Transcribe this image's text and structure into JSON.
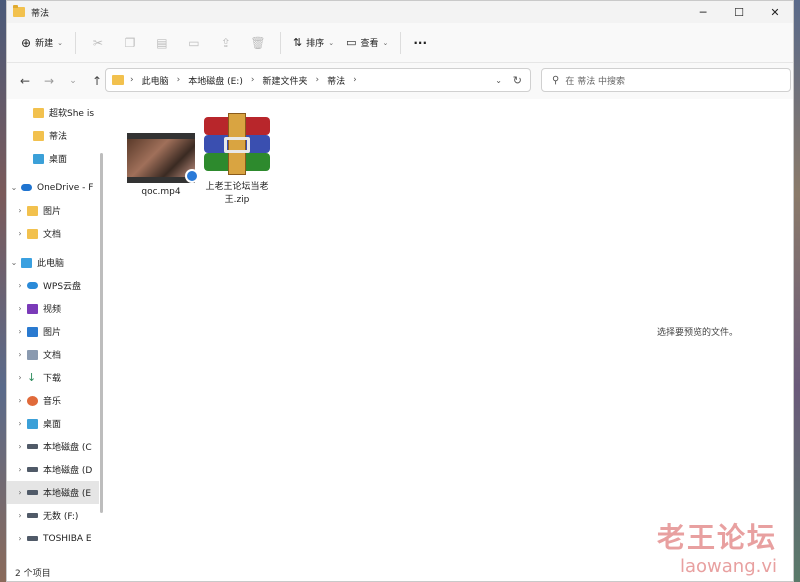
{
  "window": {
    "title": "蒂法"
  },
  "window_controls": {
    "minimize": "─",
    "maximize": "☐",
    "close": "✕"
  },
  "toolbar": {
    "new_label": "新建",
    "sort_label": "排序",
    "view_label": "查看",
    "more_label": "···"
  },
  "address_bar": {
    "crumbs": [
      "此电脑",
      "本地磁盘 (E:)",
      "新建文件夹",
      "蒂法"
    ]
  },
  "search": {
    "placeholder": "在 蒂法 中搜索"
  },
  "sidebar": {
    "items": [
      {
        "label": "超软She is",
        "icon": "folder-icon"
      },
      {
        "label": "蒂法",
        "icon": "folder-icon"
      },
      {
        "label": "桌面",
        "icon": "desktop-icon"
      },
      {
        "label": "OneDrive - F",
        "icon": "cloud-icon"
      },
      {
        "label": "图片",
        "icon": "folder-icon"
      },
      {
        "label": "文档",
        "icon": "folder-icon"
      },
      {
        "label": "此电脑",
        "icon": "computer-icon"
      },
      {
        "label": "WPS云盘",
        "icon": "cloud-icon"
      },
      {
        "label": "视频",
        "icon": "video-icon"
      },
      {
        "label": "图片",
        "icon": "picture-icon"
      },
      {
        "label": "文档",
        "icon": "document-icon"
      },
      {
        "label": "下载",
        "icon": "download-icon"
      },
      {
        "label": "音乐",
        "icon": "music-icon"
      },
      {
        "label": "桌面",
        "icon": "desktop-icon"
      },
      {
        "label": "本地磁盘 (C",
        "icon": "drive-icon"
      },
      {
        "label": "本地磁盘 (D",
        "icon": "drive-icon"
      },
      {
        "label": "本地磁盘 (E",
        "icon": "drive-icon"
      },
      {
        "label": "无数 (F:)",
        "icon": "drive-icon"
      },
      {
        "label": "TOSHIBA E",
        "icon": "drive-icon"
      }
    ]
  },
  "files": [
    {
      "name": "qoc.mp4",
      "icon": "video-file-icon"
    },
    {
      "name": "上老王论坛当老王.zip",
      "icon": "zip-archive-icon"
    }
  ],
  "preview_pane": {
    "message": "选择要预览的文件。"
  },
  "status": {
    "item_count": "2 个项目"
  },
  "watermark": {
    "line1": "老王论坛",
    "line2": "laowang.vi"
  }
}
